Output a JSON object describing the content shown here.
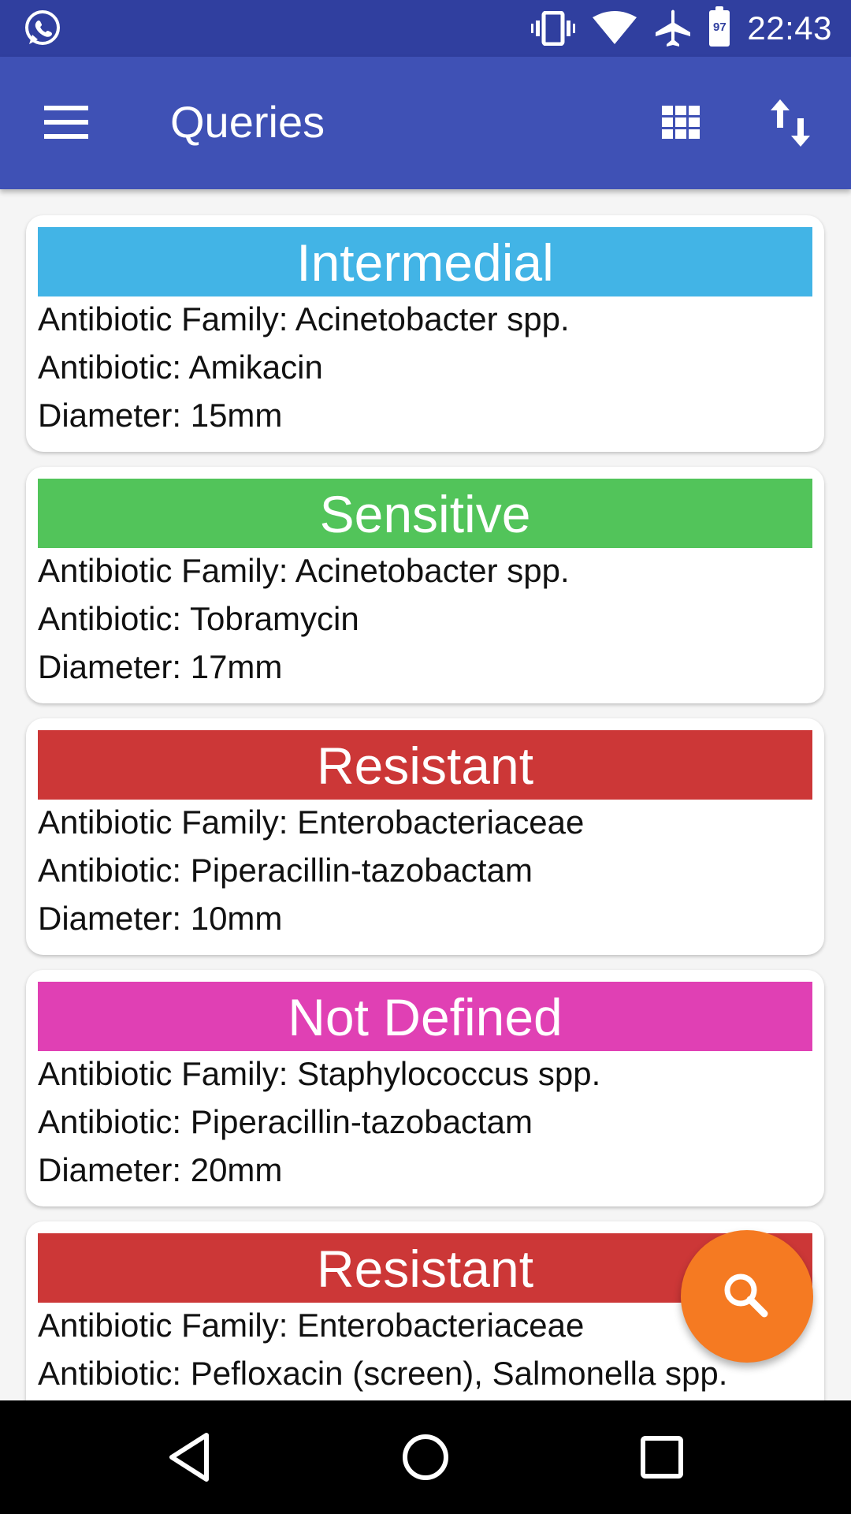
{
  "status_bar": {
    "time": "22:43",
    "battery_level": "97",
    "icons": [
      "whatsapp-icon",
      "vibrate-icon",
      "wifi-icon",
      "airplane-icon",
      "battery-icon"
    ]
  },
  "app_bar": {
    "title": "Queries",
    "icons": [
      "menu-icon",
      "grid-view-icon",
      "sort-icon"
    ]
  },
  "cards": [
    {
      "status": "Intermedial",
      "color": "#42b4e6",
      "family": "Antibiotic Family: Acinetobacter spp.",
      "antibiotic": "Antibiotic: Amikacin",
      "diameter": "Diameter: 15mm"
    },
    {
      "status": "Sensitive",
      "color": "#52c45a",
      "family": "Antibiotic Family: Acinetobacter spp.",
      "antibiotic": "Antibiotic: Tobramycin",
      "diameter": "Diameter: 17mm"
    },
    {
      "status": "Resistant",
      "color": "#cc3737",
      "family": "Antibiotic Family: Enterobacteriaceae",
      "antibiotic": "Antibiotic: Piperacillin-tazobactam",
      "diameter": "Diameter: 10mm"
    },
    {
      "status": "Not Defined",
      "color": "#e040b4",
      "family": "Antibiotic Family: Staphylococcus spp.",
      "antibiotic": "Antibiotic: Piperacillin-tazobactam",
      "diameter": "Diameter: 20mm"
    },
    {
      "status": "Resistant",
      "color": "#cc3737",
      "family": "Antibiotic Family: Enterobacteriaceae",
      "antibiotic": "Antibiotic: Pefloxacin (screen), Salmonella spp.",
      "diameter": ""
    }
  ],
  "fab": {
    "icon": "search-icon",
    "color": "#f57a22"
  },
  "nav_bar": {
    "icons": [
      "back-icon",
      "home-icon",
      "recents-icon"
    ]
  }
}
